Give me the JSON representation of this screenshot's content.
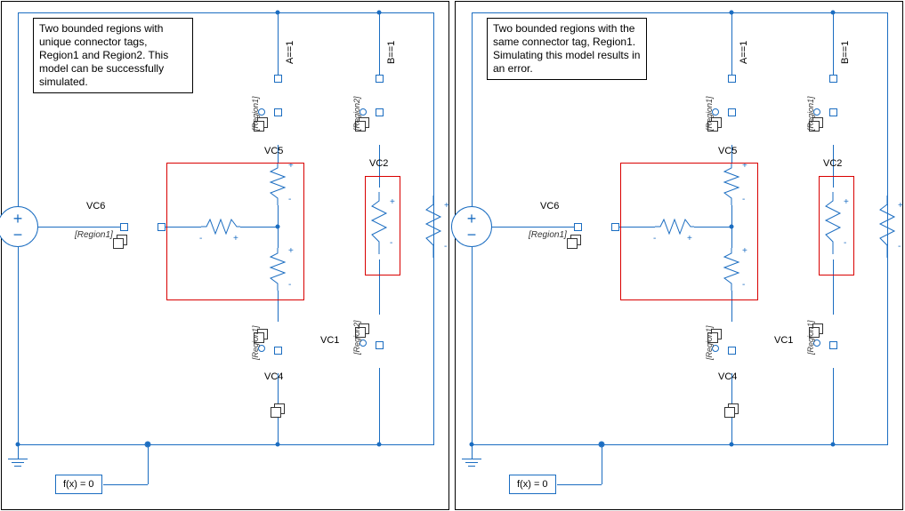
{
  "left": {
    "desc": "Two bounded regions with unique connector tags, Region1 and Region2. This model can be successfully simulated.",
    "labels": {
      "A": "A==1",
      "B": "B==1",
      "VC1": "VC1",
      "VC2": "VC2",
      "VC4": "VC4",
      "VC5": "VC5",
      "VC6": "VC6"
    },
    "tags": {
      "top_left": "[Region1]",
      "bottom_left": "[Region1]",
      "top_right": "[Region2]",
      "bottom_right": "[Region2]",
      "vc6_tag": "[Region1]"
    },
    "solver": "f(x) = 0"
  },
  "right": {
    "desc": "Two bounded regions with the same connector tag, Region1. Simulating this model results in an error.",
    "labels": {
      "A": "A==1",
      "B": "B==1",
      "VC1": "VC1",
      "VC2": "VC2",
      "VC4": "VC4",
      "VC5": "VC5",
      "VC6": "VC6"
    },
    "tags": {
      "top_left": "[Region1]",
      "bottom_left": "[Region1]",
      "top_right": "[Region1]",
      "bottom_right": "[Region1]",
      "vc6_tag": "[Region1]"
    },
    "solver": "f(x) = 0"
  },
  "symbols": {
    "plus": "+",
    "minus": "-"
  }
}
